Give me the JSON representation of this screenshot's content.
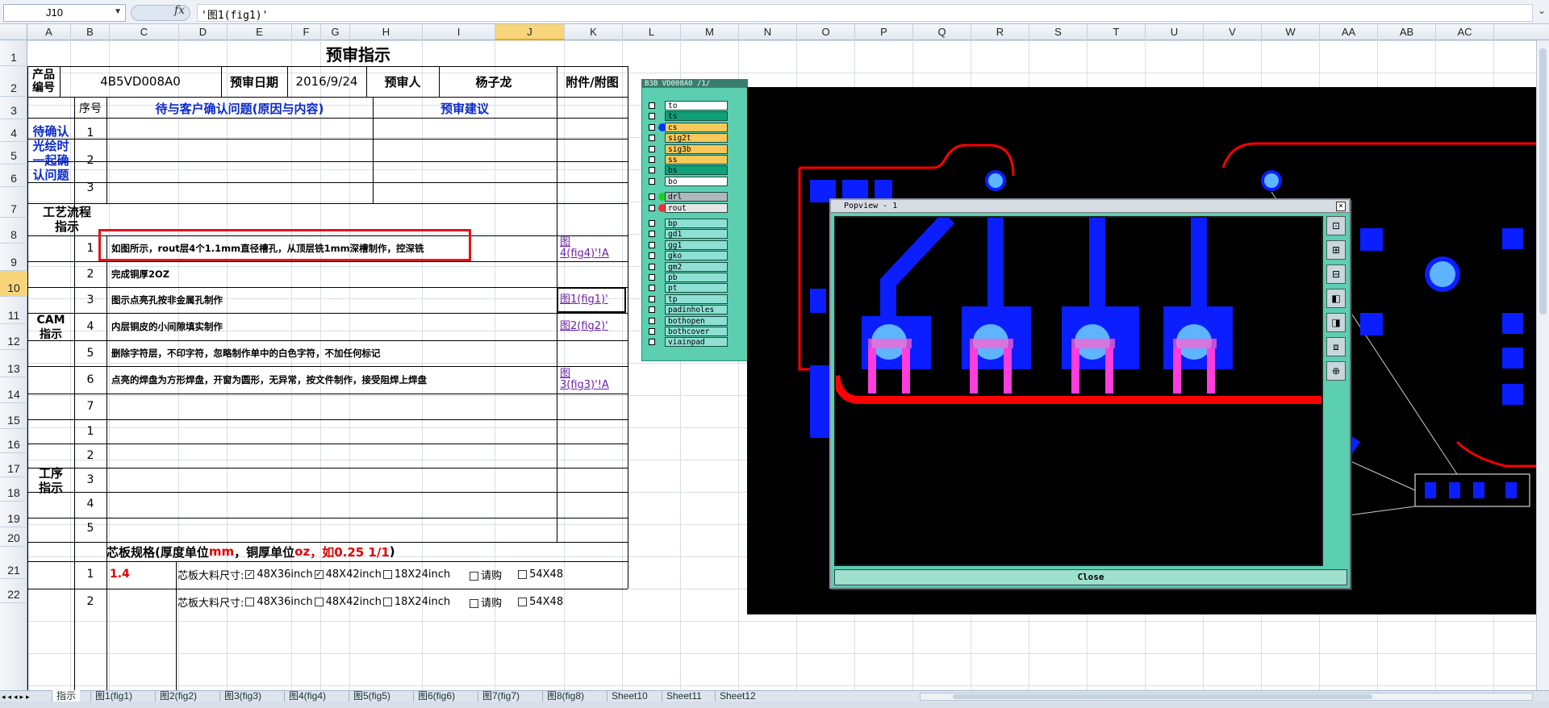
{
  "formula_bar": {
    "name_box": "J10",
    "fx": "fx",
    "formula": "'图1(fig1)'"
  },
  "columns": [
    "A",
    "B",
    "C",
    "D",
    "E",
    "F",
    "G",
    "H",
    "I",
    "J",
    "K",
    "L",
    "M",
    "N",
    "O",
    "P",
    "Q",
    "R",
    "S",
    "T",
    "U",
    "V",
    "W",
    "AA",
    "AB",
    "AC"
  ],
  "selected_column": "J",
  "rows": [
    "1",
    "2",
    "3",
    "4",
    "5",
    "6",
    "7",
    "8",
    "9",
    "10",
    "11",
    "12",
    "13",
    "14",
    "15",
    "16",
    "17",
    "18",
    "19",
    "20",
    "21",
    "22"
  ],
  "selected_row": "10",
  "sheet": {
    "title": "预审指示",
    "product_no_label": "产品\n编号",
    "product_no": "4B5VD008A0",
    "review_date_label": "预审日期",
    "review_date": "2016/9/24",
    "reviewer_label": "预审人",
    "reviewer": "杨子龙",
    "attachment_label": "附件/附图",
    "seq_label": "序号",
    "confirm_header": "待与客户确认问题(原因与内容)",
    "suggestion_header": "预审建议",
    "pending_label": "待确认\n光绘时\n一起确\n认问题",
    "process_flow_label": "工艺流程\n指示",
    "cam_label": "CAM\n指示",
    "procedure_label": "工序\n指示",
    "pending_rows": [
      "1",
      "2",
      "3"
    ],
    "cam_rows": [
      {
        "no": "1",
        "text": "如图所示，rout层4个1.1mm直径槽孔，从顶层铣1mm深槽制作，控深铣",
        "link": "图\n4(fig4)'!A"
      },
      {
        "no": "2",
        "text": "完成铜厚2OZ",
        "link": ""
      },
      {
        "no": "3",
        "text": "图示点亮孔按非金属孔制作",
        "link": "图1(fig1)'"
      },
      {
        "no": "4",
        "text": "内层铜皮的小间隙填实制作",
        "link": "图2(fig2)'"
      },
      {
        "no": "5",
        "text": "删除字符层，不印字符，忽略制作单中的白色字符，不加任何标记",
        "link": ""
      },
      {
        "no": "6",
        "text": "点亮的焊盘为方形焊盘，开窗为圆形，无异常，按文件制作，接受阻焊上焊盘",
        "link": "图\n3(fig3)'!A"
      },
      {
        "no": "7",
        "text": "",
        "link": ""
      }
    ],
    "procedure_rows": [
      "1",
      "2",
      "3",
      "4",
      "5"
    ],
    "core_spec_prefix": "芯板规格(厚度单位",
    "core_spec_mm": "mm",
    "core_spec_mid": "，铜厚单位",
    "core_spec_oz": "oz",
    "core_spec_example": "，如0.25 1/1",
    "core_spec_suffix": ")",
    "core_rows": [
      {
        "no": "1",
        "value": "1.4",
        "size_label": "芯板大料尺寸:",
        "opts": [
          {
            "label": "48X36inch",
            "checked": true
          },
          {
            "label": "48X42inch",
            "checked": true
          },
          {
            "label": "18X24inch",
            "checked": false
          },
          {
            "label": "请购",
            "checked": false
          },
          {
            "label": "54X48",
            "checked": false
          }
        ]
      },
      {
        "no": "2",
        "value": "",
        "size_label": "芯板大料尺寸:",
        "opts": [
          {
            "label": "48X36inch",
            "checked": false
          },
          {
            "label": "48X42inch",
            "checked": false
          },
          {
            "label": "18X24inch",
            "checked": false
          },
          {
            "label": "请购",
            "checked": false
          },
          {
            "label": "54X48",
            "checked": false
          }
        ]
      }
    ]
  },
  "cam_panel": {
    "title": "B3B VD008A0 /1/",
    "layers": [
      {
        "name": "to",
        "color": "#ffffff"
      },
      {
        "name": "ts",
        "color": "#0fa07a"
      },
      {
        "name": "cs",
        "color": "#f9c85a"
      },
      {
        "name": "sig2t",
        "color": "#f9c85a"
      },
      {
        "name": "sig3b",
        "color": "#f9c85a"
      },
      {
        "name": "ss",
        "color": "#f9c85a"
      },
      {
        "name": "bs",
        "color": "#0fa07a"
      },
      {
        "name": "bo",
        "color": "#ffffff"
      },
      {
        "name": "drl",
        "color": "#b0b8bc"
      },
      {
        "name": "rout",
        "color": "#e6e6e6"
      },
      {
        "name": "bp",
        "color": "#8fe0d4"
      },
      {
        "name": "gd1",
        "color": "#8fe0d4"
      },
      {
        "name": "gg1",
        "color": "#8fe0d4"
      },
      {
        "name": "gko",
        "color": "#8fe0d4"
      },
      {
        "name": "gm2",
        "color": "#8fe0d4"
      },
      {
        "name": "pb",
        "color": "#8fe0d4"
      },
      {
        "name": "pt",
        "color": "#8fe0d4"
      },
      {
        "name": "tp",
        "color": "#8fe0d4"
      },
      {
        "name": "padinholes",
        "color": "#8fe0d4"
      },
      {
        "name": "bothopen",
        "color": "#8fe0d4"
      },
      {
        "name": "bothcover",
        "color": "#8fe0d4"
      },
      {
        "name": "viainpad",
        "color": "#8fe0d4"
      }
    ]
  },
  "popview": {
    "title": "Popview - 1",
    "close_label": "Close"
  },
  "sheet_tabs": [
    "指示",
    "图1(fig1)",
    "图2(fig2)",
    "图3(fig3)",
    "图4(fig4)",
    "图5(fig5)",
    "图6(fig6)",
    "图7(fig7)",
    "图8(fig8)",
    "Sheet10",
    "Sheet11",
    "Sheet12"
  ],
  "active_tab": "指示",
  "colors": {
    "accent_blue": "#0a29c9",
    "red_box": "#e0151b",
    "pcb_blue": "#0a1eff",
    "pcb_red": "#ff0000",
    "panel_teal": "#5bcfb0"
  }
}
